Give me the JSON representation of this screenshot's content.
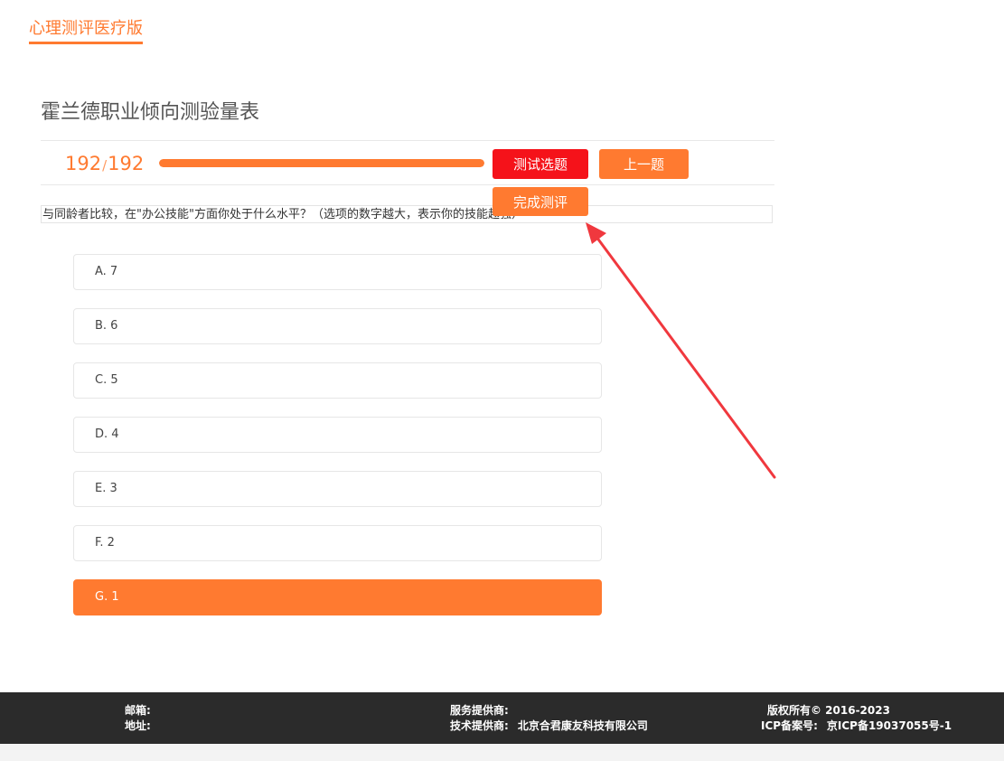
{
  "brand": "心理测评医疗版",
  "test_title": "霍兰德职业倾向测验量表",
  "progress": {
    "current": "192",
    "separator": "/",
    "total": "192",
    "fraction": 1.0
  },
  "buttons": {
    "test_select": "测试选题",
    "prev": "上一题",
    "finish": "完成测评"
  },
  "question": "与同龄者比较，在\"办公技能\"方面你处于什么水平？（选项的数字越大，表示你的技能越强）",
  "options": [
    {
      "label": "A. 7",
      "selected": false
    },
    {
      "label": "B. 6",
      "selected": false
    },
    {
      "label": "C. 5",
      "selected": false
    },
    {
      "label": "D. 4",
      "selected": false
    },
    {
      "label": "E. 3",
      "selected": false
    },
    {
      "label": "F. 2",
      "selected": false
    },
    {
      "label": "G. 1",
      "selected": true
    }
  ],
  "annotation_arrow": {
    "color": "#f0383e",
    "icon": "arrow-annotation"
  },
  "colors": {
    "accent": "#ff7a30",
    "danger": "#f5121a",
    "footer_bg": "#2b2b2b"
  },
  "footer": {
    "email_label": "邮箱:",
    "address_label": "地址:",
    "service_provider_label": "服务提供商:",
    "tech_provider_label": "技术提供商:",
    "tech_provider_value": "北京合君康友科技有限公司",
    "copyright": "版权所有© 2016-2023",
    "icp_label": "ICP备案号:",
    "icp_value": "京ICP备19037055号-1"
  }
}
